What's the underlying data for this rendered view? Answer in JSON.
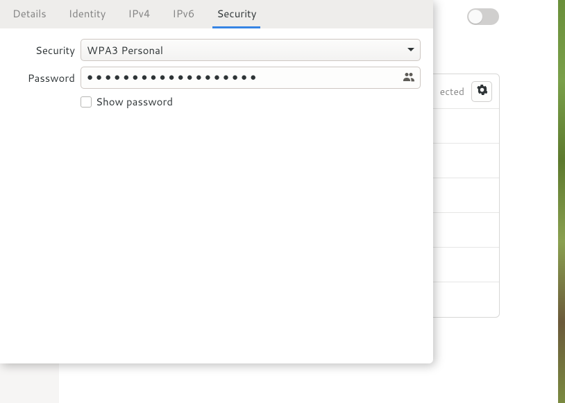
{
  "tabs": {
    "details": "Details",
    "identity": "Identity",
    "ipv4": "IPv4",
    "ipv6": "IPv6",
    "security": "Security"
  },
  "form": {
    "security_label": "Security",
    "security_value": "WPA3 Personal",
    "password_label": "Password",
    "password_mask": "●●●●●●●●●●●●●●●●●●●",
    "show_password": "Show password"
  },
  "background": {
    "known_status": "ected"
  }
}
